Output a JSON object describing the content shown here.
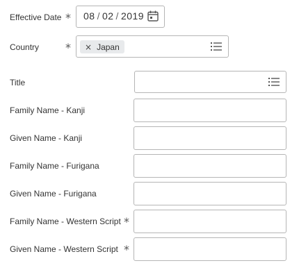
{
  "form": {
    "effective_date": {
      "label": "Effective Date",
      "required_mark": "*",
      "month": "08",
      "day": "02",
      "year": "2019",
      "separator": "/",
      "icon": "calendar-icon"
    },
    "country": {
      "label": "Country",
      "required_mark": "*",
      "selected": "Japan",
      "remove_glyph": "×",
      "icon": "list-icon"
    },
    "title": {
      "label": "Title",
      "value": "",
      "icon": "list-icon"
    },
    "family_name_kanji": {
      "label": "Family Name - Kanji",
      "value": ""
    },
    "given_name_kanji": {
      "label": "Given Name - Kanji",
      "value": ""
    },
    "family_name_furigana": {
      "label": "Family Name - Furigana",
      "value": ""
    },
    "given_name_furigana": {
      "label": "Given Name - Furigana",
      "value": ""
    },
    "family_name_western": {
      "label": "Family Name - Western Script",
      "required_mark": "*",
      "value": ""
    },
    "given_name_western": {
      "label": "Given Name - Western Script",
      "required_mark": "*",
      "value": ""
    }
  }
}
